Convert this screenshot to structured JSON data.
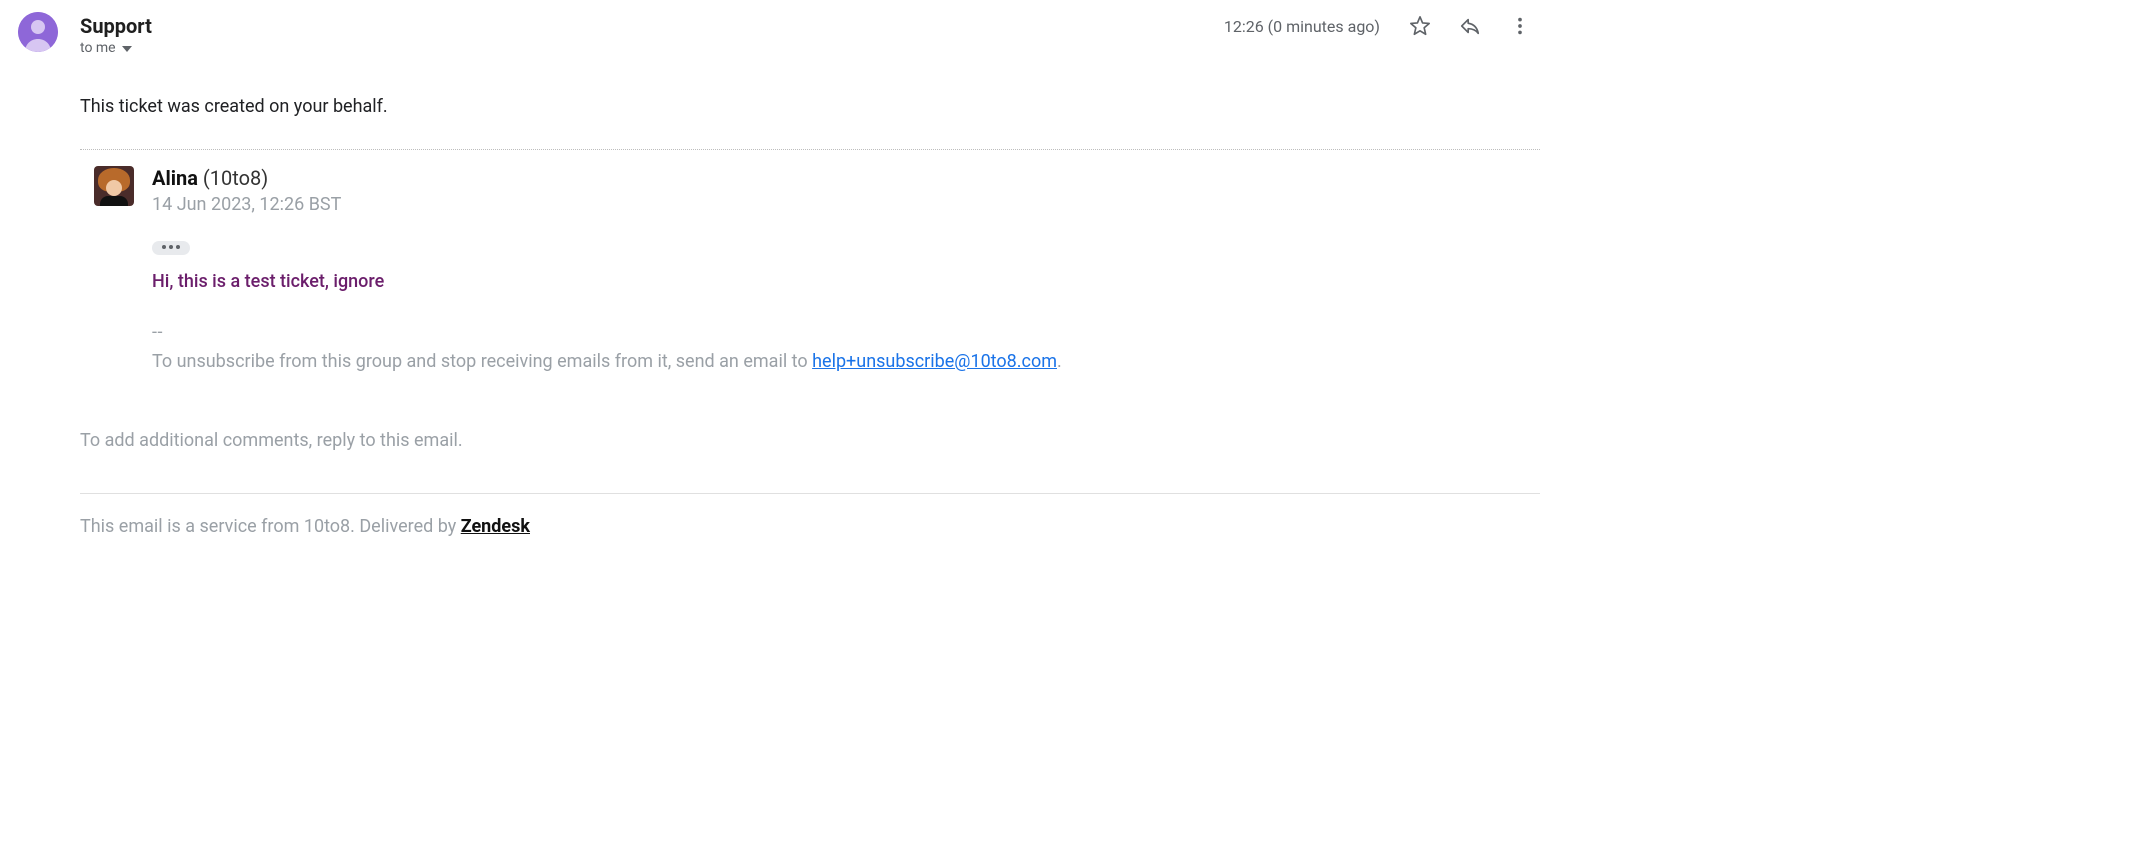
{
  "header": {
    "sender_name": "Support",
    "to_label": "to me",
    "timestamp": "12:26 (0 minutes ago)"
  },
  "message": {
    "intro": "This ticket was created on your behalf.",
    "agent_name": "Alina",
    "agent_org": "(10to8)",
    "agent_timestamp": "14 Jun 2023, 12:26 BST",
    "body_text": "Hi, this is a test ticket, ignore",
    "dashes": "--",
    "unsubscribe_prefix": "To unsubscribe from this group and stop receiving emails from it, send an email to ",
    "unsubscribe_email": "help+unsubscribe@10to8.com",
    "unsubscribe_period": ".",
    "reply_hint": "To add additional comments, reply to this email."
  },
  "footer": {
    "service_text": "This email is a service from 10to8. Delivered by ",
    "zendesk_label": "Zendesk"
  }
}
